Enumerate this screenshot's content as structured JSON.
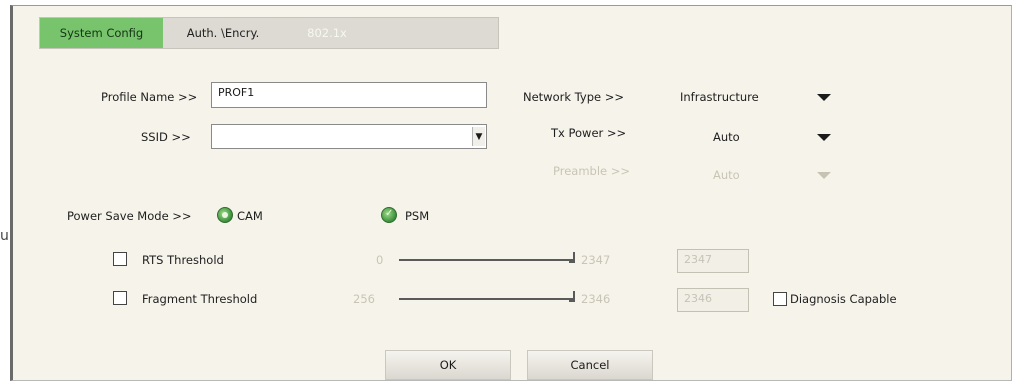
{
  "tabs": [
    {
      "label": "System Config"
    },
    {
      "label": "Auth. \\Encry."
    },
    {
      "label": "802.1x"
    }
  ],
  "profile": {
    "label": "Profile Name >>",
    "value": "PROF1"
  },
  "ssid": {
    "label": "SSID >>",
    "value": ""
  },
  "network_type": {
    "label": "Network Type >>",
    "value": "Infrastructure"
  },
  "tx_power": {
    "label": "Tx Power >>",
    "value": "Auto"
  },
  "preamble": {
    "label": "Preamble >>",
    "value": "Auto"
  },
  "power_save": {
    "label": "Power Save Mode >>",
    "cam": "CAM",
    "psm": "PSM"
  },
  "rts": {
    "label": "RTS Threshold",
    "min": "0",
    "max": "2347",
    "value": "2347"
  },
  "fragment": {
    "label": "Fragment Threshold",
    "min": "256",
    "max": "2346",
    "value": "2346"
  },
  "diagnosis": {
    "label": "Diagnosis Capable"
  },
  "buttons": {
    "ok": "OK",
    "cancel": "Cancel"
  },
  "side_mark": "u"
}
